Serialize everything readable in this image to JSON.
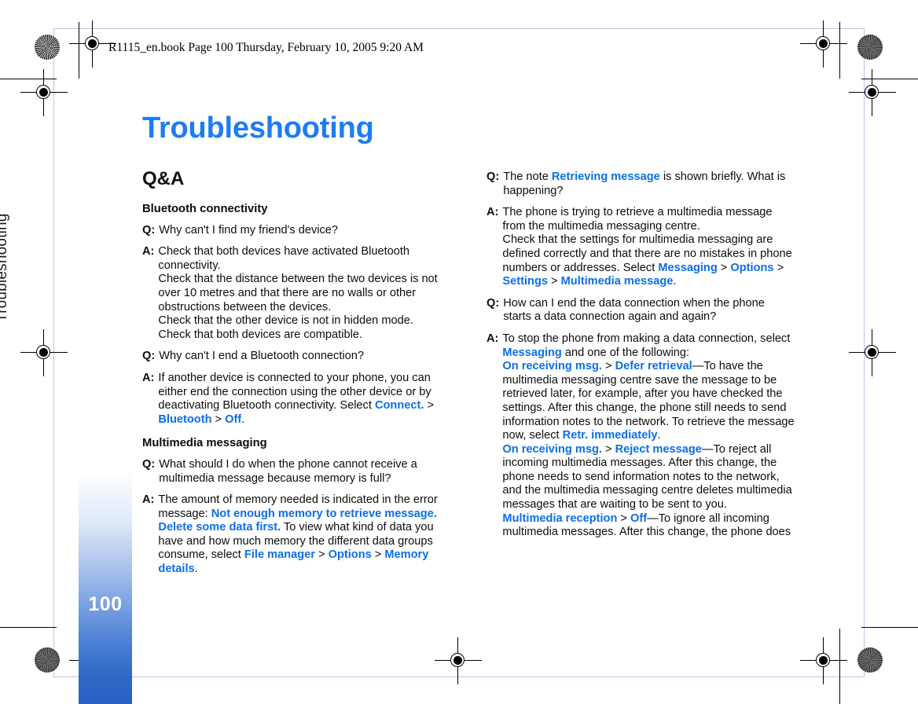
{
  "page": {
    "book_header": "R1115_en.book  Page 100  Thursday, February 10, 2005  9:20 AM",
    "number": "100",
    "running_head": "Troubleshooting",
    "chapter_title": "Troubleshooting",
    "section_title": "Q&A"
  },
  "left_column": {
    "subhead_bluetooth": "Bluetooth connectivity",
    "subhead_multimedia": "Multimedia messaging",
    "q1_tag": "Q:",
    "q1_text": "Why can't I find my friend's device?",
    "a1_tag": "A:",
    "a1_p1": "Check that both devices have activated Bluetooth connectivity.",
    "a1_p2": "Check that the distance between the two devices is not over 10 metres and that there are no walls or other obstructions between the devices.",
    "a1_p3": "Check that the other device is not in hidden mode.",
    "a1_p4": "Check that both devices are compatible.",
    "q2_tag": "Q:",
    "q2_text": "Why can't I end a Bluetooth connection?",
    "a2_tag": "A:",
    "a2_part1": "If another device is connected to your phone, you can either end the connection using the other device or by deactivating Bluetooth connectivity. Select ",
    "a2_link1": "Connect.",
    "a2_sep1": " > ",
    "a2_link2": "Bluetooth",
    "a2_sep2": " > ",
    "a2_link3": "Off",
    "a2_end": ".",
    "q3_tag": "Q:",
    "q3_text": "What should I do when the phone cannot receive a multimedia message because memory is full?",
    "a3_tag": "A:",
    "a3_part1": "The amount of memory needed is indicated in the error message: ",
    "a3_link1": "Not enough memory to retrieve message. Delete some data first.",
    "a3_part2": " To view what kind of data you have and how much memory the different data groups consume, select ",
    "a3_link2": "File manager",
    "a3_sep1": " > ",
    "a3_link3": "Options",
    "a3_sep2": " > ",
    "a3_link4": "Memory details",
    "a3_end": "."
  },
  "right_column": {
    "q1_tag": "Q:",
    "q1_part1": "The note ",
    "q1_link1": "Retrieving message",
    "q1_part2": " is shown briefly. What is happening?",
    "a1_tag": "A:",
    "a1_p1": "The phone is trying to retrieve a multimedia message from the multimedia messaging centre.",
    "a1_p2_part1": "Check that the settings for multimedia messaging are defined correctly and that there are no mistakes in phone numbers or addresses. Select ",
    "a1_link1": "Messaging",
    "a1_sep1": " > ",
    "a1_link2": "Options",
    "a1_sep2": " > ",
    "a1_link3": "Settings",
    "a1_sep3": " > ",
    "a1_link4": "Multimedia message",
    "a1_end": ".",
    "q2_tag": "Q:",
    "q2_text": "How can I end the data connection when the phone starts a data connection again and again?",
    "a2_tag": "A:",
    "a2_part1": "To stop the phone from making a data connection, select ",
    "a2_link1": "Messaging",
    "a2_part2": " and one of the following:",
    "a2_link2": "On receiving msg.",
    "a2_sep1": " > ",
    "a2_link3": "Defer retrieval",
    "a2_part3": "—To have the multimedia messaging centre save the message to be retrieved later, for example, after you have checked the settings. After this change, the phone still needs to send information notes to the network. To retrieve the message now, select ",
    "a2_link4": "Retr. immediately",
    "a2_part4": ".",
    "a2_link5": "On receiving msg.",
    "a2_sep2": " > ",
    "a2_link6": "Reject message",
    "a2_part5": "—To reject all incoming multimedia messages. After this change, the phone needs to send information notes to the network, and the multimedia messaging centre deletes multimedia messages that are waiting to be sent to you.",
    "a2_link7": "Multimedia reception",
    "a2_sep3": " > ",
    "a2_link8": "Off",
    "a2_part6": "—To ignore all incoming multimedia messages. After this change, the phone does"
  },
  "colors": {
    "title_blue": "#1d7cf2",
    "link_blue": "#0c6fe3",
    "strip_blue": "#2862c2",
    "page_box_blue": "#b9c6e8"
  }
}
